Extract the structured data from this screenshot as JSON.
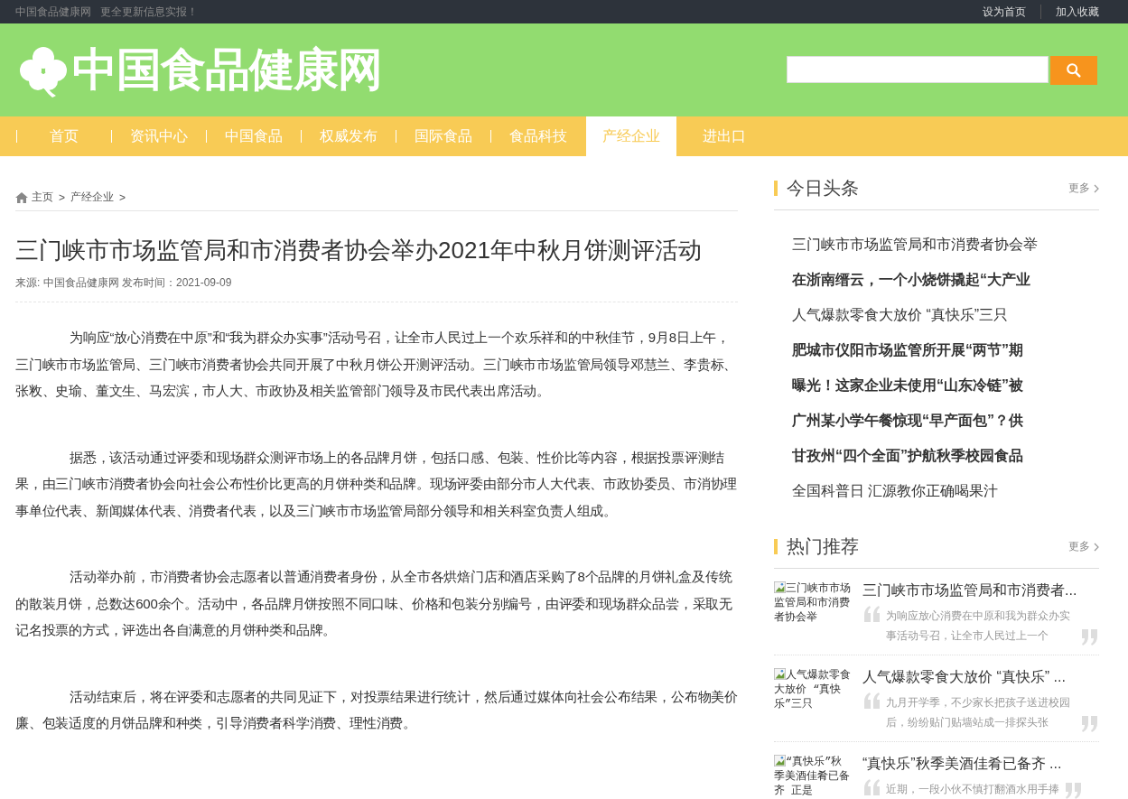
{
  "topbar": {
    "site_name": "中国食品健康网",
    "slogan": "更全更新信息实报！",
    "links": [
      "设为首页",
      "加入收藏"
    ]
  },
  "header": {
    "logo_text": "中国食品健康网"
  },
  "nav": [
    {
      "label": "首页",
      "selected": false
    },
    {
      "label": "资讯中心",
      "selected": false
    },
    {
      "label": "中国食品",
      "selected": false
    },
    {
      "label": "权威发布",
      "selected": false
    },
    {
      "label": "国际食品",
      "selected": false
    },
    {
      "label": "食品科技",
      "selected": false
    },
    {
      "label": "产经企业",
      "selected": true
    },
    {
      "label": "进出口",
      "selected": false
    }
  ],
  "breadcrumb": [
    {
      "label": "主页"
    },
    {
      "label": "产经企业"
    }
  ],
  "breadcrumb_separator": ">",
  "article": {
    "title": "三门峡市市场监管局和市消费者协会举办2021年中秋月饼测评活动",
    "meta": "来源: 中国食品健康网 发布时间：2021-09-09",
    "paragraphs": [
      "为响应“放心消费在中原”和“我为群众办实事”活动号召，让全市人民过上一个欢乐祥和的中秋佳节，9月8日上午，三门峡市市场监管局、三门峡市消费者协会共同开展了中秋月饼公开测评活动。三门峡市市场监管局领导邓慧兰、李贵标、张敉、史瑜、董文生、马宏滨，市人大、市政协及相关监管部门领导及市民代表出席活动。",
      "据悉，该活动通过评委和现场群众测评市场上的各品牌月饼，包括口感、包装、性价比等内容，根据投票评测结果，由三门峡市消费者协会向社会公布性价比更高的月饼种类和品牌。现场评委由部分市人大代表、市政协委员、市消协理事单位代表、新闻媒体代表、消费者代表，以及三门峡市市场监管局部分领导和相关科室负责人组成。",
      "活动举办前，市消费者协会志愿者以普通消费者身份，从全市各烘焙门店和酒店采购了8个品牌的月饼礼盒及传统的散装月饼，总数达600余个。活动中，各品牌月饼按照不同口味、价格和包装分别编号，由评委和现场群众品尝，采取无记名投票的方式，评选出各自满意的月饼种类和品牌。",
      "活动结束后，将在评委和志愿者的共同见证下，对投票结果进行统计，然后通过媒体向社会公布结果，公布物美价廉、包装适度的月饼品牌和种类，引导消费者科学消费、理性消费。"
    ]
  },
  "headlines": {
    "title": "今日头条",
    "more": "更多",
    "items": [
      {
        "text": "三门峡市市场监管局和市消费者协会举",
        "bold": false
      },
      {
        "text": "在浙南缙云，一个小烧饼撬起“大产业",
        "bold": true
      },
      {
        "text": "人气爆款零食大放价 “真快乐”三只",
        "bold": false
      },
      {
        "text": "肥城市仪阳市场监管所开展“两节”期",
        "bold": true
      },
      {
        "text": "曝光！这家企业未使用“山东冷链”被",
        "bold": true
      },
      {
        "text": "广州某小学午餐惊现“早产面包”？供",
        "bold": true
      },
      {
        "text": "甘孜州“四个全面”护航秋季校园食品",
        "bold": true
      },
      {
        "text": "全国科普日 汇源教你正确喝果汁",
        "bold": false
      }
    ]
  },
  "recommended": {
    "title": "热门推荐",
    "more": "更多",
    "items": [
      {
        "image_alt": "三门峡市市场监管局和市消费者协会举",
        "title": "三门峡市市场监管局和市消费者...",
        "excerpt": "为响应放心消费在中原和我为群众办实事活动号召，让全市人民过上一个"
      },
      {
        "image_alt": "人气爆款零食大放价 “真快乐”三只",
        "title": "人气爆款零食大放价 “真快乐” ...",
        "excerpt": "九月开学季，不少家长把孩子送进校园后，纷纷贴门贴墙站成一排探头张"
      },
      {
        "image_alt": "“真快乐”秋季美酒佳肴已备齐 正是",
        "title": "“真快乐”秋季美酒佳肴已备齐 ...",
        "excerpt": "近期，一段小伙不慎打翻酒水用手捧"
      }
    ]
  }
}
